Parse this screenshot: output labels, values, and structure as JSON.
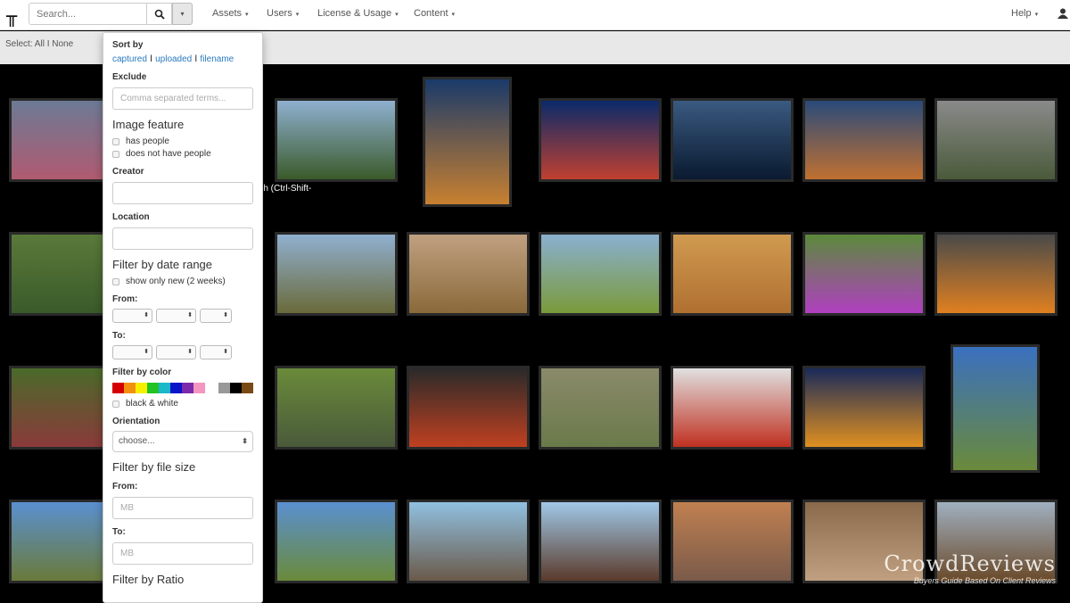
{
  "header": {
    "logo": "╥",
    "search_placeholder": "Search...",
    "nav": [
      "Assets",
      "Users",
      "License & Usage",
      "Content"
    ],
    "help": "Help",
    "caret": "▾"
  },
  "select_bar": "Select: All I None",
  "tooltip": "rch (Ctrl-Shift-\n)",
  "panel": {
    "sort_by": "Sort by",
    "sort_links": [
      "captured",
      "uploaded",
      "filename"
    ],
    "sep": " I ",
    "exclude": "Exclude",
    "exclude_placeholder": "Comma separated terms...",
    "image_feature": "Image feature",
    "has_people": "has people",
    "no_people": "does not have people",
    "creator": "Creator",
    "location": "Location",
    "date_range": "Filter by date range",
    "show_new": "show only new (2 weeks)",
    "from": "From:",
    "to": "To:",
    "filter_color": "Filter by color",
    "colors": [
      "#d40000",
      "#f39010",
      "#f5f000",
      "#22c322",
      "#1ab8c8",
      "#0a14c8",
      "#7a2aaa",
      "#f596c0",
      "#ffffff",
      "#999999",
      "#000000",
      "#7a4a14"
    ],
    "bw": "black & white",
    "orientation": "Orientation",
    "orientation_value": "choose...",
    "file_size": "Filter by file size",
    "mb": "MB",
    "ratio": "Filter by Ratio"
  },
  "tiles": [
    {
      "c": [
        "#6c7a95",
        "#b05a70"
      ]
    },
    {
      "c": [
        "#8fb0d0",
        "#3a5a2a"
      ]
    },
    {
      "c": [
        "#1a3a6a",
        "#c88030"
      ]
    },
    {
      "c": [
        "#0a2a6a",
        "#c04030"
      ]
    },
    {
      "c": [
        "#3a5a80",
        "#0a1a30"
      ]
    },
    {
      "c": [
        "#2a4a7a",
        "#c07030"
      ]
    },
    {
      "c": [
        "#8a8a8a",
        "#4a5a3a"
      ]
    },
    {
      "c": [
        "#5a7a3a",
        "#3a5a2a"
      ]
    },
    {
      "c": [
        "#90b0d0",
        "#6a6a3a"
      ]
    },
    {
      "c": [
        "#c0a080",
        "#8a6a3a"
      ]
    },
    {
      "c": [
        "#8ab0d0",
        "#7a9a3a"
      ]
    },
    {
      "c": [
        "#d09a50",
        "#b07030"
      ]
    },
    {
      "c": [
        "#5a8a3a",
        "#b040c0"
      ]
    },
    {
      "c": [
        "#4a4a4a",
        "#e08020"
      ]
    },
    {
      "c": [
        "#4a6a2a",
        "#8a3a3a"
      ]
    },
    {
      "c": [
        "#6a8a3a",
        "#4a5a3a"
      ]
    },
    {
      "c": [
        "#2a2a2a",
        "#c04020"
      ]
    },
    {
      "c": [
        "#8a8a6a",
        "#6a7a4a"
      ]
    },
    {
      "c": [
        "#e0e0e0",
        "#c03020"
      ]
    },
    {
      "c": [
        "#1a2a5a",
        "#e09020"
      ]
    },
    {
      "c": [
        "#3a70c0",
        "#6a8a3a"
      ]
    },
    {
      "c": [
        "#5a90d0",
        "#6a7a3a"
      ]
    },
    {
      "c": [
        "#5a90d0",
        "#6a8a3a"
      ]
    },
    {
      "c": [
        "#90c0e0",
        "#6a5a4a"
      ]
    },
    {
      "c": [
        "#a0c8e8",
        "#5a3a2a"
      ]
    },
    {
      "c": [
        "#c08050",
        "#7a5a4a"
      ]
    },
    {
      "c": [
        "#8a6a4a",
        "#c0a080"
      ]
    },
    {
      "c": [
        "#a0b0c0",
        "#6a4a2a"
      ]
    }
  ],
  "watermark": {
    "title": "CrowdReviews",
    "subtitle": "Buyers Guide Based On Client Reviews"
  }
}
